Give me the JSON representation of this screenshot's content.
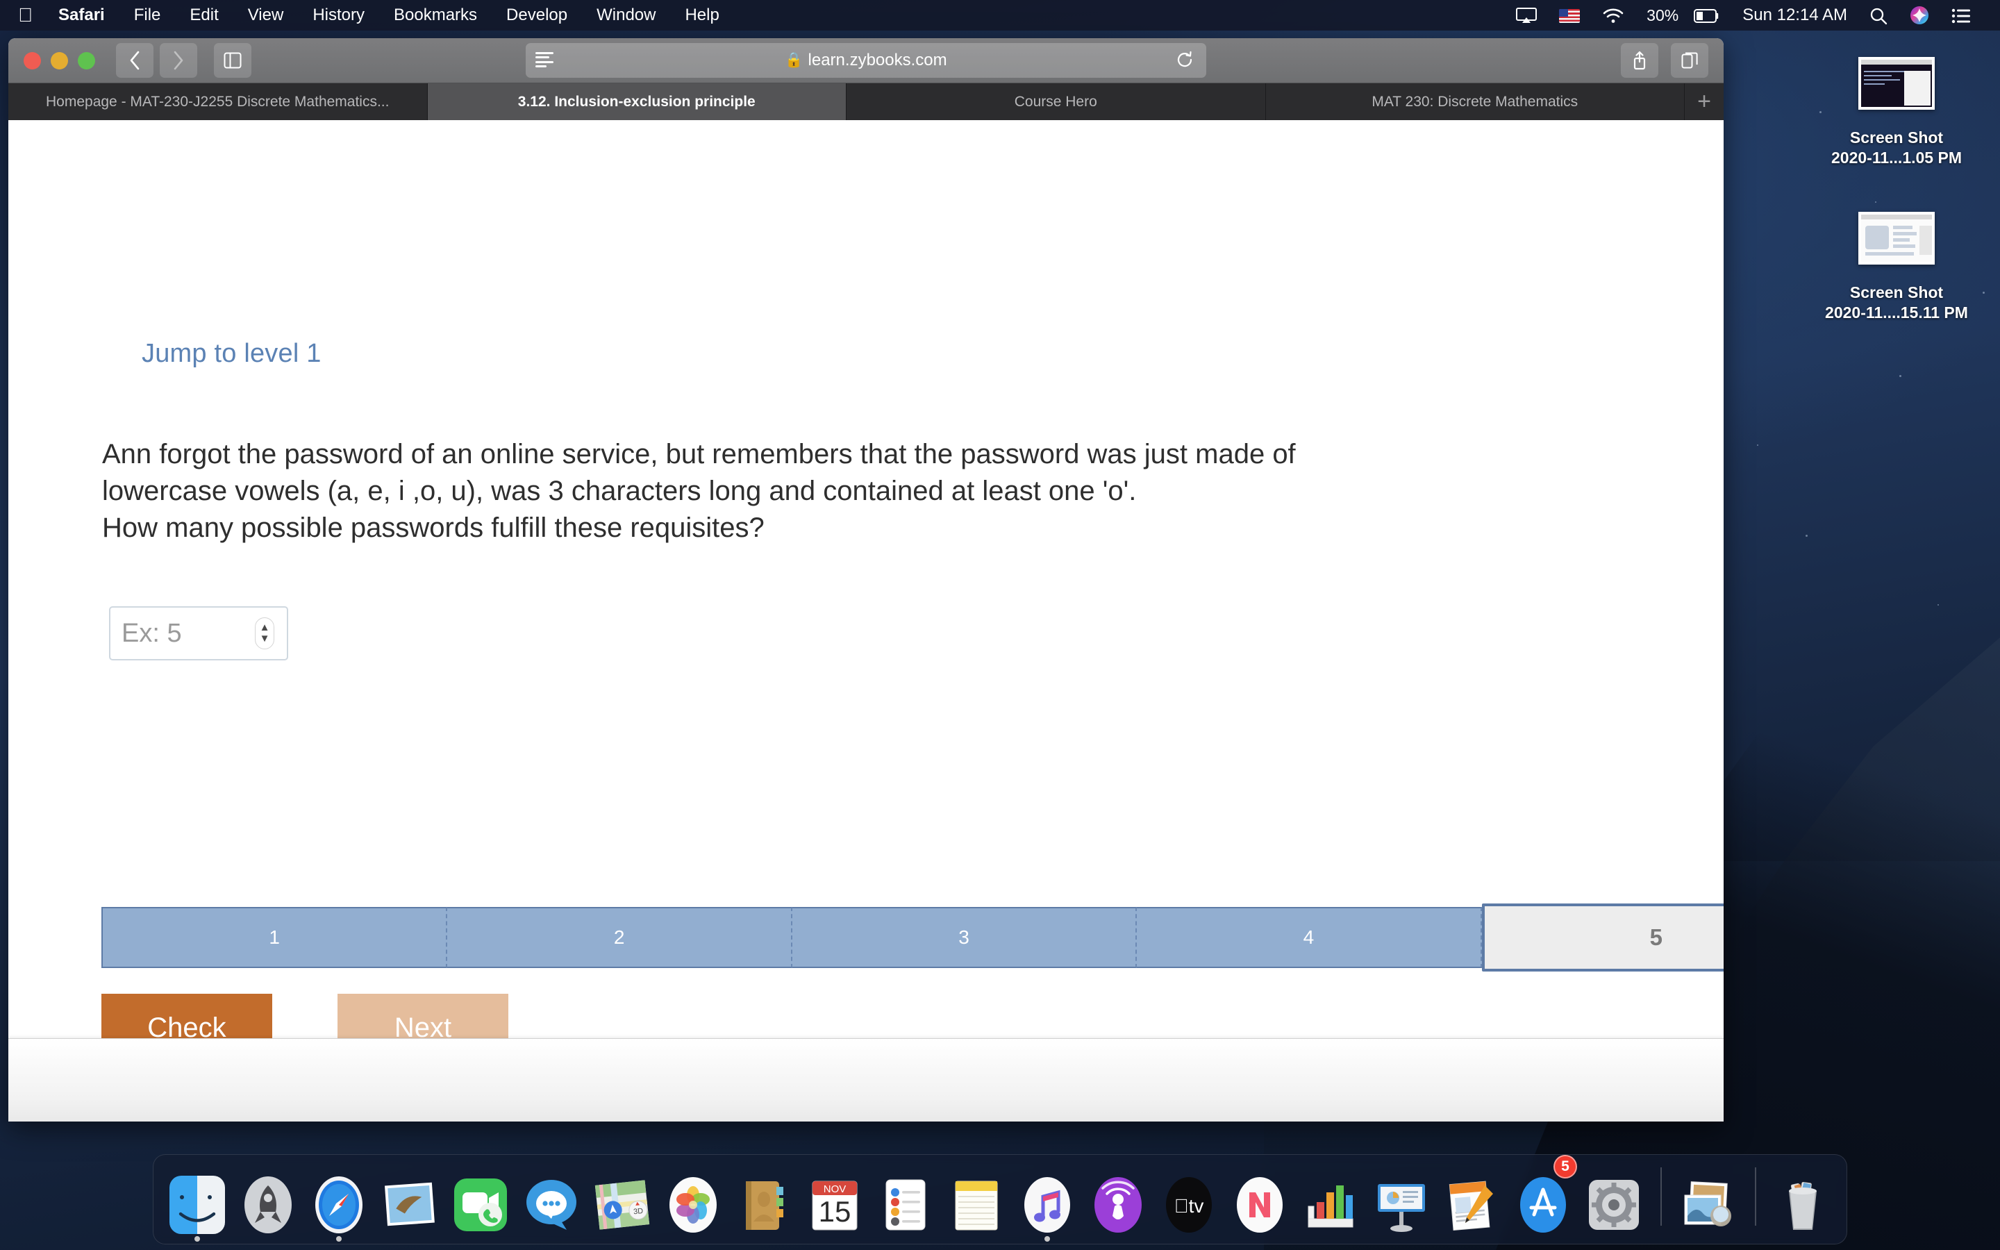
{
  "menubar": {
    "apple_icon": "apple-logo",
    "items": [
      "Safari",
      "File",
      "Edit",
      "View",
      "History",
      "Bookmarks",
      "Develop",
      "Window",
      "Help"
    ],
    "app_name": "Safari",
    "battery": "30%",
    "clock": "Sun 12:14 AM",
    "status_icons": [
      "airplay-icon",
      "us-flag-icon",
      "wifi-icon",
      "battery-icon",
      "search-icon",
      "siri-icon",
      "control-center-icon"
    ]
  },
  "browser": {
    "url": "learn.zybooks.com",
    "url_lock": "ὑ2",
    "back_label": "‹",
    "forward_label": "›",
    "sidebar_icon": "sidebar-icon",
    "reader_icon": "reader-icon",
    "reload_icon": "reload-icon",
    "share_icon": "share-icon",
    "tabs_overview_icon": "tab-overview-icon",
    "new_tab_label": "+",
    "tabs": [
      {
        "label": "Homepage - MAT-230-J2255 Discrete Mathematics...",
        "active": false
      },
      {
        "label": "3.12. Inclusion-exclusion principle",
        "active": true
      },
      {
        "label": "Course Hero",
        "active": false
      },
      {
        "label": "MAT 230: Discrete Mathematics",
        "active": false
      }
    ]
  },
  "content": {
    "jump_link": "Jump to level 1",
    "question_line1": "Ann forgot the password of an online service, but remembers that the password was just made of",
    "question_line2": "lowercase vowels (a, e, i ,o, u), was 3 characters long and contained at least one 'o'.",
    "question_line3": "How many possible passwords fulfill these requisites?",
    "answer_placeholder": "Ex: 5",
    "answer_value": "",
    "stepper_up": "▲",
    "stepper_down": "▼",
    "levels": [
      "1",
      "2",
      "3",
      "4",
      "5"
    ],
    "current_level": "5",
    "check_label": "Check",
    "next_label": "Next",
    "colors": {
      "check_button": "#c26c2c",
      "next_button": "#e5bd9c",
      "level_filled": "#92aed0",
      "level_border": "#5d7ba6",
      "level_current_bg": "#ededed",
      "link": "#5b82b4"
    }
  },
  "desktop": {
    "icons": [
      {
        "name_line1": "Screen Shot",
        "name_line2": "2020-11...1.05 PM",
        "thumb": "terminal-screenshot"
      },
      {
        "name_line1": "Screen Shot",
        "name_line2": "2020-11....15.11 PM",
        "thumb": "document-screenshot"
      }
    ]
  },
  "dock": {
    "items": [
      {
        "name": "Finder",
        "running": true
      },
      {
        "name": "Launchpad",
        "running": false
      },
      {
        "name": "Safari",
        "running": true
      },
      {
        "name": "Mail",
        "running": false
      },
      {
        "name": "FaceTime",
        "running": false
      },
      {
        "name": "Messages",
        "running": false
      },
      {
        "name": "Maps",
        "running": false
      },
      {
        "name": "Photos",
        "running": false
      },
      {
        "name": "Contacts",
        "running": false
      },
      {
        "name": "Calendar",
        "running": false,
        "month": "NOV",
        "day": "15"
      },
      {
        "name": "Reminders",
        "running": false
      },
      {
        "name": "Notes",
        "running": false
      },
      {
        "name": "Music",
        "running": true
      },
      {
        "name": "Podcasts",
        "running": false
      },
      {
        "name": "Apple TV",
        "running": false
      },
      {
        "name": "News",
        "running": false
      },
      {
        "name": "Numbers",
        "running": false
      },
      {
        "name": "Keynote",
        "running": false
      },
      {
        "name": "Pages",
        "running": false
      },
      {
        "name": "App Store",
        "running": false,
        "badge": "5"
      },
      {
        "name": "System Preferences",
        "running": false
      }
    ],
    "right_items": [
      {
        "name": "Preview",
        "running": false
      },
      {
        "name": "Trash",
        "running": false
      }
    ]
  }
}
